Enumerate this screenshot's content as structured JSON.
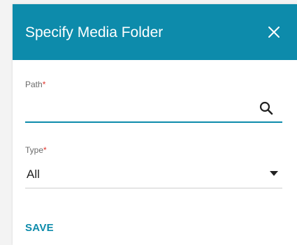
{
  "dialog": {
    "title": "Specify Media Folder",
    "close_icon": "close-icon",
    "header_color": "#0d8bab"
  },
  "path_field": {
    "label": "Path",
    "required_marker": "*",
    "value": "",
    "placeholder": "",
    "icon": "search-icon",
    "underline_color": "#0d8bab"
  },
  "type_field": {
    "label": "Type",
    "required_marker": "*",
    "value": "All",
    "icon": "caret-down-icon"
  },
  "actions": {
    "save_label": "SAVE",
    "accent_color": "#0d8bab"
  },
  "colors": {
    "required": "#e0332b"
  }
}
